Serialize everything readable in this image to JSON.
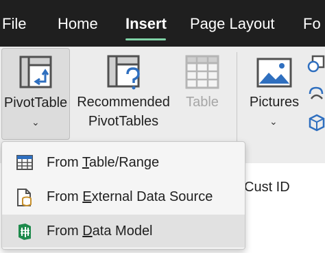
{
  "tabs": [
    {
      "label": "File"
    },
    {
      "label": "Home"
    },
    {
      "label": "Insert",
      "active": true
    },
    {
      "label": "Page Layout"
    },
    {
      "label": "Fo"
    }
  ],
  "ribbon": {
    "pivot_table": {
      "label": "PivotTable",
      "icon": "pivot-table-icon"
    },
    "recommended": {
      "line1": "Recommended",
      "line2": "PivotTables",
      "icon": "recommended-pivot-icon"
    },
    "table": {
      "label": "Table",
      "icon": "table-icon",
      "disabled": true
    },
    "pictures": {
      "label": "Pictures",
      "icon": "pictures-icon"
    },
    "chevron": "⌄"
  },
  "sheet": {
    "column_header": "Cust ID"
  },
  "menu": {
    "items": [
      {
        "prefix": "From ",
        "key": "T",
        "suffix": "able/Range",
        "icon": "table-range-icon"
      },
      {
        "prefix": "From ",
        "key": "E",
        "suffix": "xternal Data Source",
        "icon": "external-data-icon"
      },
      {
        "prefix": "From ",
        "key": "D",
        "suffix": "ata Model",
        "icon": "data-model-icon",
        "hover": true
      }
    ]
  },
  "colors": {
    "tab_bar": "#1f1f1f",
    "active_underline": "#7fd3a6",
    "icon_blue": "#2f6fbf",
    "data_model_green": "#1e8a4c",
    "disabled_text": "#a6a6a6"
  }
}
